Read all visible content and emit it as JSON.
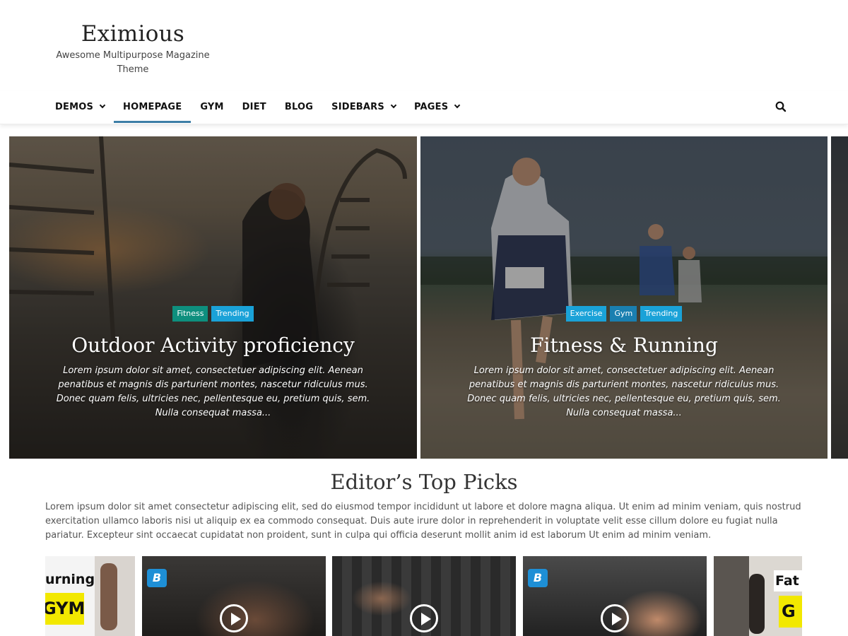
{
  "site": {
    "title": "Eximious",
    "description": "Awesome Multipurpose Magazine Theme"
  },
  "nav": {
    "items": [
      {
        "label": "DEMOS",
        "has_dropdown": true,
        "active": false
      },
      {
        "label": "HOMEPAGE",
        "has_dropdown": false,
        "active": true
      },
      {
        "label": "GYM",
        "has_dropdown": false,
        "active": false
      },
      {
        "label": "DIET",
        "has_dropdown": false,
        "active": false
      },
      {
        "label": "BLOG",
        "has_dropdown": false,
        "active": false
      },
      {
        "label": "SIDEBARS",
        "has_dropdown": true,
        "active": false
      },
      {
        "label": "PAGES",
        "has_dropdown": true,
        "active": false
      }
    ],
    "search_icon": "search-icon",
    "active_color": "#3d7ea6"
  },
  "slides": [
    {
      "title": "Outdoor Activity proficiency",
      "categories": [
        {
          "label": "Fitness",
          "color": "#0e8f7e"
        },
        {
          "label": "Trending",
          "color": "#1aa2d8"
        }
      ],
      "excerpt": "Lorem ipsum dolor sit amet, consectetuer adipiscing elit. Aenean penatibus et magnis dis parturient montes, nascetur ridiculus mus. Donec quam felis, ultricies nec, pellentesque eu, pretium quis, sem. Nulla consequat massa..."
    },
    {
      "title": "Fitness & Running",
      "categories": [
        {
          "label": "Exercise",
          "color": "#1aa2d8"
        },
        {
          "label": "Gym",
          "color": "#1a7fb0"
        },
        {
          "label": "Trending",
          "color": "#1aa2d8"
        }
      ],
      "excerpt": "Lorem ipsum dolor sit amet, consectetuer adipiscing elit. Aenean penatibus et magnis dis parturient montes, nascetur ridiculus mus. Donec quam felis, ultricies nec, pellentesque eu, pretium quis, sem. Nulla consequat massa..."
    }
  ],
  "editors_picks": {
    "title": "Editor’s Top Picks",
    "text": "Lorem ipsum dolor sit amet consectetur adipiscing elit, sed do eiusmod tempor incididunt ut labore et dolore magna aliqua. Ut enim ad minim veniam, quis nostrud exercitation ullamco laboris nisi ut aliquip ex ea commodo consequat. Duis aute irure dolor in reprehenderit in voluptate velit esse cillum dolore eu fugiat nulla pariatur. Excepteur sint occaecat cupidatat non proident, sunt in culpa qui officia deserunt mollit anim id est laborum Ut enim ad minim veniam.",
    "videos": [
      {
        "overlay_text_1": "urning",
        "overlay_text_2": "GYM"
      },
      {
        "logo": "B"
      },
      {
        "badge": ""
      },
      {
        "logo": "B"
      },
      {
        "overlay_text_1": "Fat B",
        "overlay_text_2": "G"
      }
    ]
  }
}
